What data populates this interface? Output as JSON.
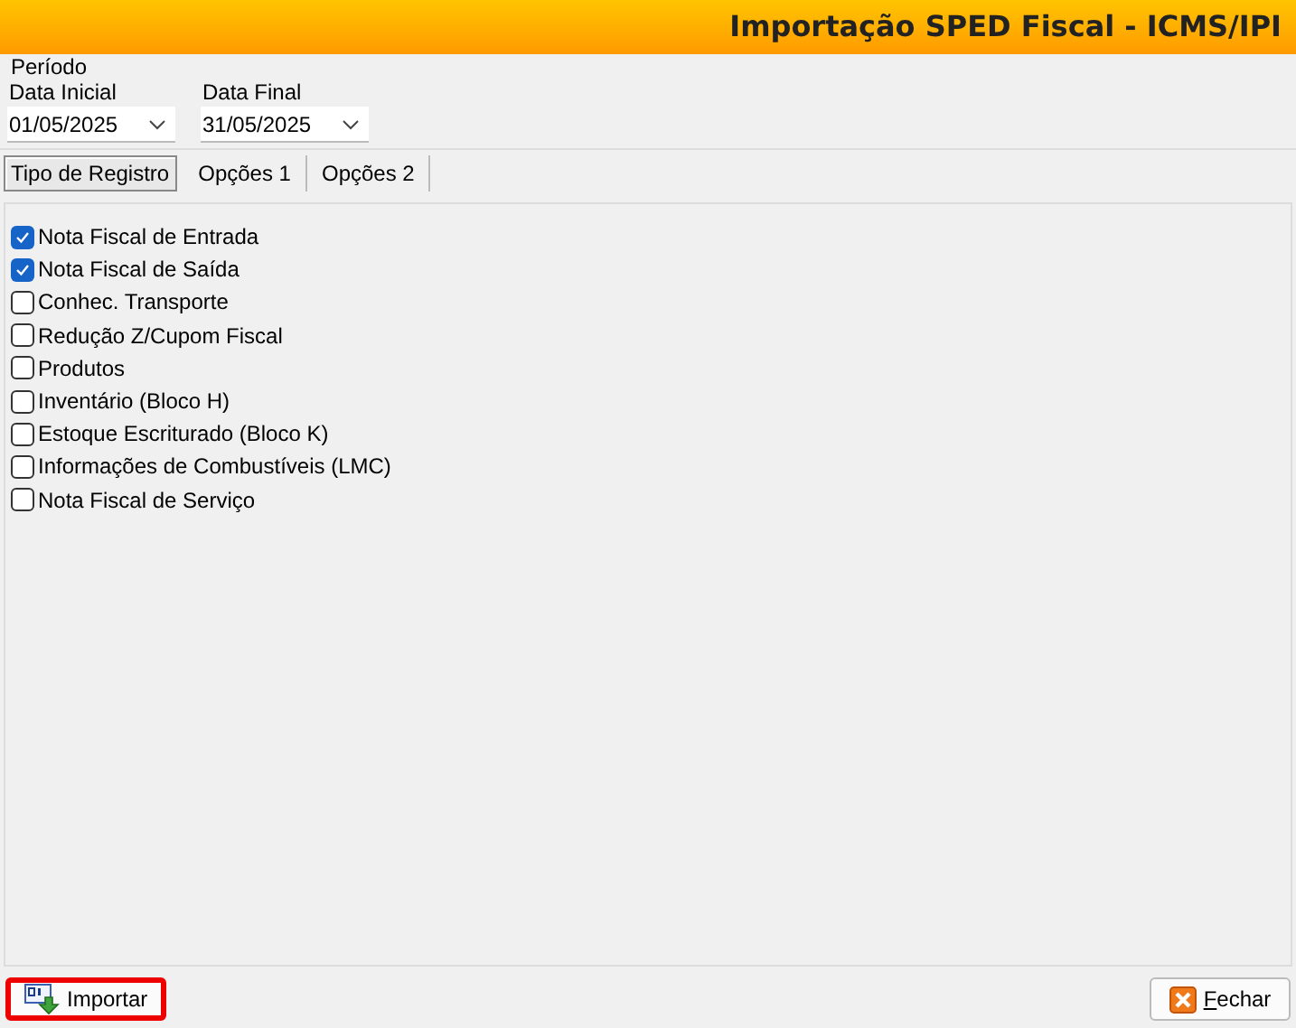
{
  "window": {
    "title": "Importação SPED Fiscal - ICMS/IPI"
  },
  "period": {
    "label": "Período",
    "fields": [
      {
        "label": "Data Inicial",
        "value": "01/05/2025"
      },
      {
        "label": "Data Final",
        "value": "31/05/2025"
      }
    ]
  },
  "tabs": [
    {
      "label": "Tipo de Registro",
      "selected": true
    },
    {
      "label": "Opções 1",
      "selected": false
    },
    {
      "label": "Opções 2",
      "selected": false
    }
  ],
  "records": [
    {
      "label": "Nota Fiscal de Entrada",
      "checked": true
    },
    {
      "label": "Nota Fiscal de Saída",
      "checked": true
    },
    {
      "label": "Conhec. Transporte",
      "checked": false
    },
    {
      "label": "Redução Z/Cupom Fiscal",
      "checked": false
    },
    {
      "label": "Produtos",
      "checked": false
    },
    {
      "label": "Inventário (Bloco H)",
      "checked": false
    },
    {
      "label": "Estoque Escriturado (Bloco K)",
      "checked": false
    },
    {
      "label": "Informações de Combustíveis (LMC)",
      "checked": false
    },
    {
      "label": "Nota Fiscal de Serviço",
      "checked": false
    }
  ],
  "buttons": [
    {
      "kind": "import",
      "label": "Importar",
      "focused": true
    },
    {
      "kind": "close",
      "label": "Fechar",
      "focused": false
    }
  ]
}
